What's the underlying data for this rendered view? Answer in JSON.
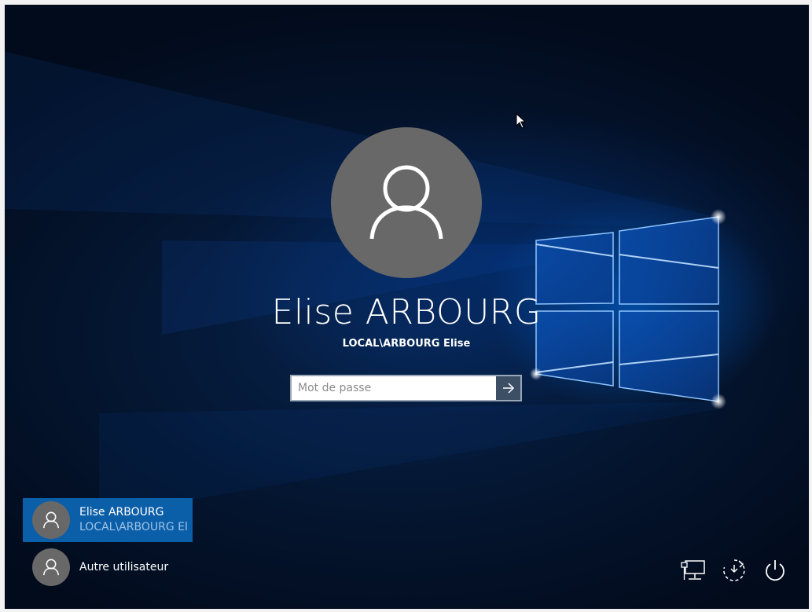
{
  "lock_screen": {
    "user_name": "Elise ARBOURG",
    "user_domain": "LOCAL\\ARBOURG Elise",
    "password": {
      "placeholder": "Mot de passe",
      "value": ""
    },
    "submit_icon": "arrow-right-icon"
  },
  "user_list": [
    {
      "name": "Elise ARBOURG",
      "account": "LOCAL\\ARBOURG El",
      "selected": true,
      "icon": "user-icon"
    },
    {
      "name": "Autre utilisateur",
      "account": "",
      "selected": false,
      "icon": "user-icon"
    }
  ],
  "corner_icons": [
    "network-icon",
    "ease-of-access-icon",
    "power-icon"
  ],
  "colors": {
    "background": "#04152f",
    "selected_user": "#0b5ea8",
    "avatar": "#686868",
    "submit_button": "#3c4f64"
  }
}
